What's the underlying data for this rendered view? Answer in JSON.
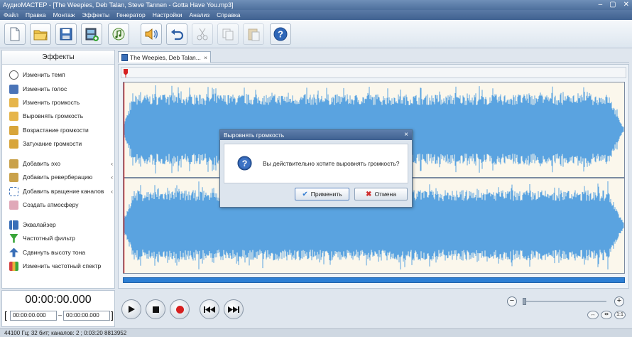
{
  "app": {
    "window_title": "АудиоМАСТЕР - [The Weepies, Deb Talan, Steve Tannen - Gotta Have You.mp3]"
  },
  "menu": [
    "Файл",
    "Правка",
    "Монтаж",
    "Эффекты",
    "Генератор",
    "Настройки",
    "Анализ",
    "Справка"
  ],
  "toolbar": {
    "buttons": [
      "new-file-icon",
      "open-folder-icon",
      "save-icon",
      "add-video-icon",
      "add-music-icon",
      "audio-wizard-icon",
      "undo-icon",
      "cut-icon",
      "copy-icon",
      "paste-icon",
      "help-icon"
    ]
  },
  "effects_panel": {
    "title": "Эффекты",
    "items": [
      {
        "label": "Изменить темп",
        "icon": "clock-icon"
      },
      {
        "label": "Изменить голос",
        "icon": "person-icon"
      },
      {
        "label": "Изменить громкость",
        "icon": "speaker-icon"
      },
      {
        "label": "Выровнять громкость",
        "icon": "speaker-level-icon"
      },
      {
        "label": "Возрастание громкости",
        "icon": "speaker-up-icon"
      },
      {
        "label": "Затухание громкости",
        "icon": "speaker-down-icon"
      },
      {
        "label": "Добавить эхо",
        "icon": "echo-icon"
      },
      {
        "label": "Добавить реверберацию",
        "icon": "reverb-icon"
      },
      {
        "label": "Добавить вращение каналов",
        "icon": "rotate-channels-icon"
      },
      {
        "label": "Создать атмосферу",
        "icon": "atmosphere-icon"
      },
      {
        "label": "Эквалайзер",
        "icon": "equalizer-icon"
      },
      {
        "label": "Частотный фильтр",
        "icon": "filter-icon"
      },
      {
        "label": "Сдвинуть высоту тона",
        "icon": "pitch-icon"
      },
      {
        "label": "Изменить частотный спектр",
        "icon": "spectrum-icon"
      }
    ]
  },
  "tab": {
    "label": "The Weepies, Deb Talan...",
    "close": "×"
  },
  "dialog": {
    "title": "Выровнять громкость",
    "close": "×",
    "message": "Вы действительно хотите выровнять громкость?",
    "apply_label": "Применить",
    "cancel_label": "Отмена"
  },
  "time": {
    "current": "00:00:00.000",
    "start": "00:00:00.000",
    "separator": "–",
    "end": "00:00:00.000"
  },
  "zoom": {
    "minus": "−",
    "plus": "+",
    "fit_label": "↔",
    "sel_label": "⇹",
    "one_label": "1:1"
  },
  "status": {
    "text": "44100 Гц; 32 бит; каналов: 2 ; 0:03:20 8813952"
  },
  "colors": {
    "wave": "#5aa3e0",
    "wave_bg": "#fbf7ec",
    "accent": "#2d7fd4"
  }
}
